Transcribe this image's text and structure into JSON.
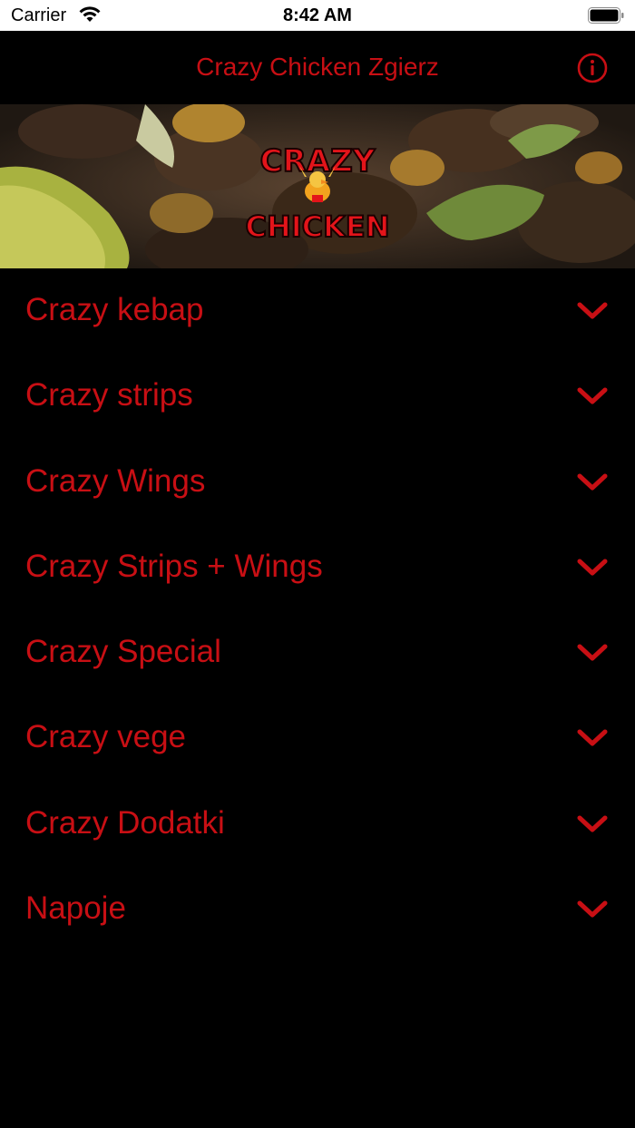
{
  "status_bar": {
    "carrier": "Carrier",
    "time": "8:42 AM"
  },
  "nav": {
    "title": "Crazy Chicken Zgierz",
    "info_icon": "info-circle-icon"
  },
  "banner": {
    "logo_line1": "CRAZY",
    "logo_line2": "CHICKEN"
  },
  "menu": {
    "items": [
      {
        "label": "Crazy kebap"
      },
      {
        "label": "Crazy strips"
      },
      {
        "label": "Crazy Wings"
      },
      {
        "label": "Crazy Strips + Wings"
      },
      {
        "label": "Crazy Special"
      },
      {
        "label": "Crazy vege"
      },
      {
        "label": "Crazy Dodatki"
      },
      {
        "label": "Napoje"
      }
    ]
  },
  "colors": {
    "accent": "#c80f14",
    "background": "#000000"
  }
}
